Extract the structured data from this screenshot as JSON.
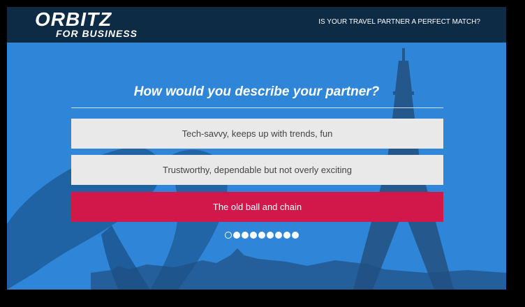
{
  "brand": {
    "logo_main": "ORBITZ",
    "logo_sub": "FOR BUSINESS"
  },
  "header": {
    "tagline": "IS YOUR TRAVEL PARTNER A PERFECT MATCH?"
  },
  "quiz": {
    "question": "How would you describe your partner?",
    "options": [
      {
        "label": "Tech-savvy, keeps up with trends, fun",
        "selected": false
      },
      {
        "label": "Trustworthy, dependable but not overly exciting",
        "selected": false
      },
      {
        "label": "The old ball and chain",
        "selected": true
      }
    ],
    "progress": {
      "total": 9,
      "current": 1
    }
  },
  "colors": {
    "header_bg": "#0e2b46",
    "hero_bg": "#2f86d9",
    "selected_option": "#d2184a",
    "option_bg": "#e9e9e9"
  }
}
